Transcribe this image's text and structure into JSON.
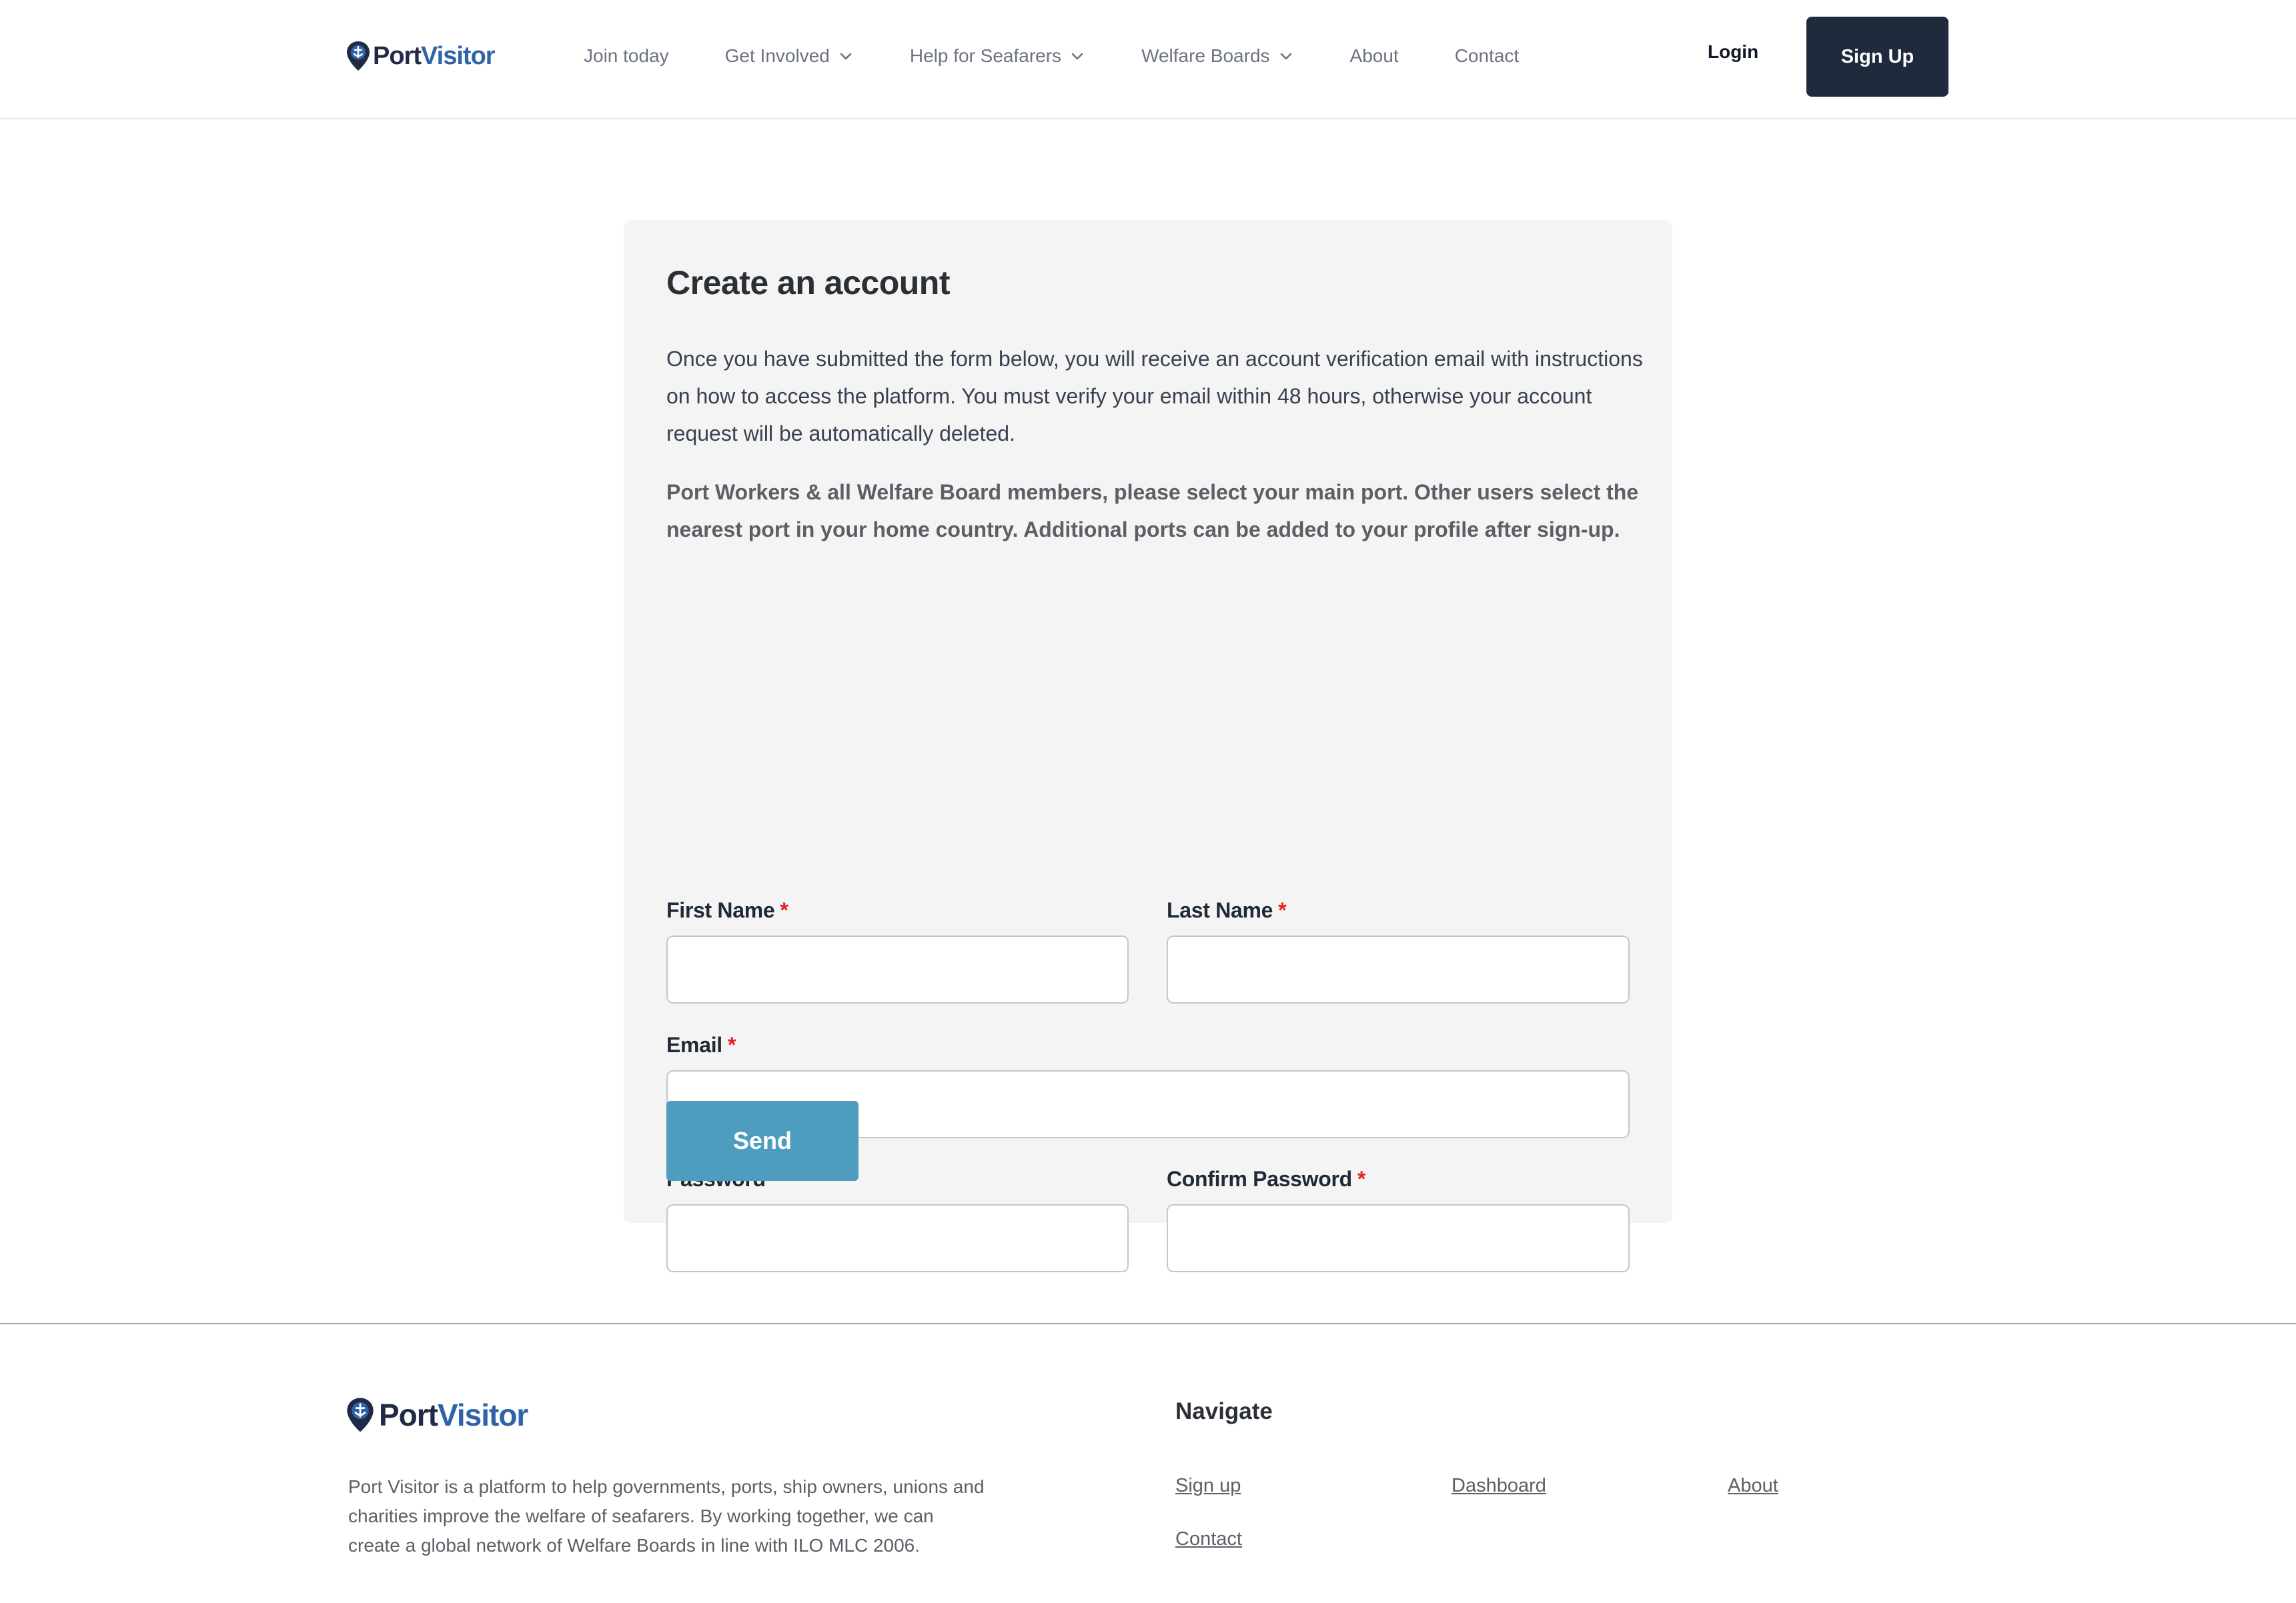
{
  "brand": {
    "name_part1": "Port",
    "name_part2": "Visitor",
    "primary_color": "#1f2a44",
    "accent_color": "#2f63a8"
  },
  "nav": {
    "items": [
      {
        "label": "Join today",
        "has_dropdown": false
      },
      {
        "label": "Get Involved",
        "has_dropdown": true
      },
      {
        "label": "Help for Seafarers",
        "has_dropdown": true
      },
      {
        "label": "Welfare Boards",
        "has_dropdown": true
      },
      {
        "label": "About",
        "has_dropdown": false
      },
      {
        "label": "Contact",
        "has_dropdown": false
      }
    ],
    "login_label": "Login",
    "signup_label": "Sign Up"
  },
  "form": {
    "title": "Create an account",
    "intro": "Once you have submitted the form below, you will receive an account verification email with instructions on how to access the platform. You must verify your email within 48 hours, otherwise your account request will be automatically deleted.",
    "notice": "Port Workers & all Welfare Board members, please select your main port. Other users select the nearest port in your home country. Additional ports can be added to your profile after sign-up.",
    "required_marker": "*",
    "fields": {
      "first_name": {
        "label": "First Name",
        "value": ""
      },
      "last_name": {
        "label": "Last Name",
        "value": ""
      },
      "email": {
        "label": "Email",
        "value": ""
      },
      "password": {
        "label": "Password",
        "value": ""
      },
      "confirm_password": {
        "label": "Confirm Password",
        "value": ""
      }
    },
    "submit_label": "Send",
    "submit_color": "#4e9cbe"
  },
  "footer": {
    "description": "Port Visitor is a platform to help governments, ports, ship owners, unions and charities improve the welfare of seafarers. By working together, we can create a global network of Welfare Boards in line with ILO MLC 2006.",
    "navigate_heading": "Navigate",
    "links": {
      "sign_up": "Sign up",
      "dashboard": "Dashboard",
      "about": "About",
      "contact": "Contact"
    }
  },
  "icons": {
    "logo": "map-pin-icon",
    "dropdown": "chevron-down-icon"
  }
}
